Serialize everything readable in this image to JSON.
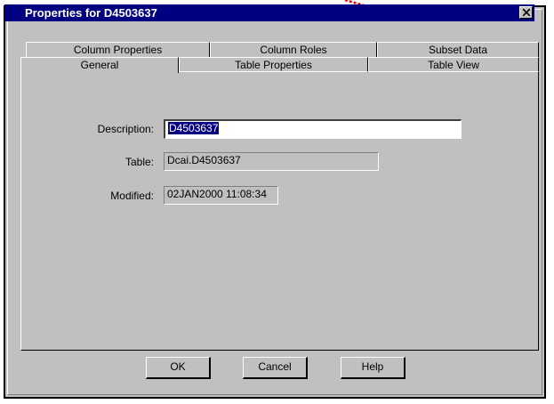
{
  "window": {
    "title": "Properties for D4503637"
  },
  "tabs": {
    "row1": [
      {
        "label": "Column Properties"
      },
      {
        "label": "Column Roles"
      },
      {
        "label": "Subset Data"
      }
    ],
    "row2": [
      {
        "label": "General"
      },
      {
        "label": "Table Properties"
      },
      {
        "label": "Table View"
      }
    ],
    "active": "General"
  },
  "form": {
    "description_label": "Description:",
    "description_value": "D4503637",
    "table_label": "Table:",
    "table_value": "Dcai.D4503637",
    "modified_label": "Modified:",
    "modified_value": "02JAN2000 11:08:34"
  },
  "buttons": {
    "ok": "OK",
    "cancel": "Cancel",
    "help": "Help"
  },
  "colors": {
    "titlebar": "#000080",
    "dialog": "#c0c0c0",
    "annotation_arrow": "#ff0000"
  }
}
